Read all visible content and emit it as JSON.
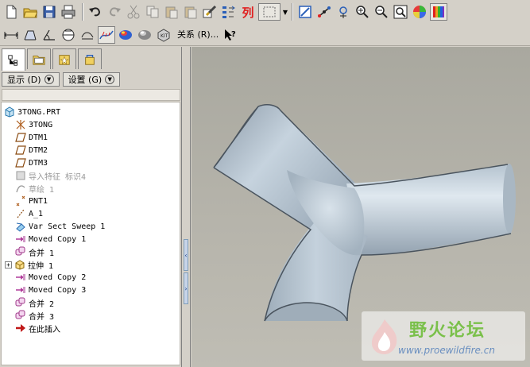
{
  "toolbar_top": {
    "buttons": [
      "new-file",
      "open-folder",
      "save",
      "print",
      "undo",
      "redo",
      "cut",
      "copy",
      "paste",
      "paste-special",
      "regenerate",
      "reorder",
      "column",
      "select-box",
      "repaint",
      "datum-axis",
      "spin-center",
      "zoom-in",
      "zoom-out",
      "refit",
      "model-appearance",
      "color-palette"
    ],
    "column_label": "列"
  },
  "toolbar_bottom": {
    "relations_label": "关系 (R)...",
    "help_label": "?"
  },
  "left_panel": {
    "tabs": [
      "model-tree",
      "layers",
      "favorites",
      "connections"
    ],
    "show_menu": "显示 (D)",
    "settings_menu": "设置 (G)"
  },
  "tree": {
    "items": [
      {
        "label": "3TONG.PRT",
        "icon": "part-icon",
        "dim": false,
        "indent": 0
      },
      {
        "label": "3TONG",
        "icon": "csys-icon",
        "dim": false,
        "indent": 1
      },
      {
        "label": "DTM1",
        "icon": "datum-plane-icon",
        "dim": false,
        "indent": 1
      },
      {
        "label": "DTM2",
        "icon": "datum-plane-icon",
        "dim": false,
        "indent": 1
      },
      {
        "label": "DTM3",
        "icon": "datum-plane-icon",
        "dim": false,
        "indent": 1
      },
      {
        "label": "导入特征 标识4",
        "icon": "import-feature-icon",
        "dim": true,
        "indent": 1
      },
      {
        "label": "草绘 1",
        "icon": "sketch-icon",
        "dim": true,
        "indent": 1
      },
      {
        "label": "PNT1",
        "icon": "datum-point-icon",
        "dim": false,
        "indent": 1
      },
      {
        "label": "A_1",
        "icon": "datum-axis-icon",
        "dim": false,
        "indent": 1
      },
      {
        "label": "Var Sect Sweep 1",
        "icon": "sweep-icon",
        "dim": false,
        "indent": 1
      },
      {
        "label": "Moved Copy 1",
        "icon": "moved-copy-icon",
        "dim": false,
        "indent": 1
      },
      {
        "label": "合并 1",
        "icon": "merge-icon",
        "dim": false,
        "indent": 1
      },
      {
        "label": "拉伸 1",
        "icon": "extrude-icon",
        "dim": false,
        "indent": 1,
        "expandable": true
      },
      {
        "label": "Moved Copy 2",
        "icon": "moved-copy-icon",
        "dim": false,
        "indent": 1
      },
      {
        "label": "Moved Copy 3",
        "icon": "moved-copy-icon",
        "dim": false,
        "indent": 1
      },
      {
        "label": "合并 2",
        "icon": "merge-icon",
        "dim": false,
        "indent": 1
      },
      {
        "label": "合并 3",
        "icon": "merge-icon",
        "dim": false,
        "indent": 1
      },
      {
        "label": "在此插入",
        "icon": "insert-here-arrow-icon",
        "dim": false,
        "indent": 1
      }
    ]
  },
  "watermark": {
    "title": "野火论坛",
    "url": "www.proewildfire.cn"
  },
  "colors": {
    "model_surface": "#b9c7d4",
    "viewport_bg": "#b4b2a9",
    "accent_blue": "#1a3e8a"
  }
}
